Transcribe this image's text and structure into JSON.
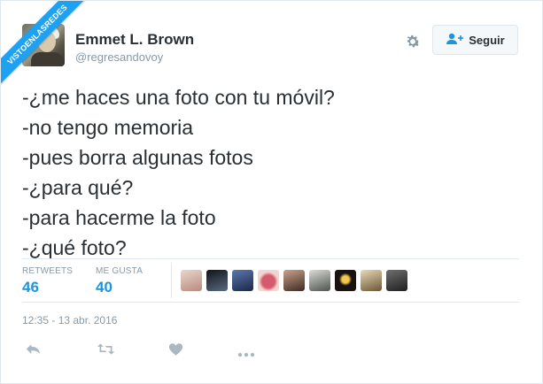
{
  "watermark": {
    "text": "VISTOENLASREDES"
  },
  "author": {
    "name": "Emmet L. Brown",
    "handle": "@regresandovoy"
  },
  "follow_button": {
    "label": "Seguir",
    "icon": "add-user-icon"
  },
  "settings_icon": "gear-icon",
  "tweet": {
    "lines": [
      "-¿me haces una foto con tu móvil?",
      "-no tengo memoria",
      "-pues borra algunas fotos",
      "-¿para qué?",
      "-para hacerme la foto",
      "-¿qué foto?"
    ]
  },
  "stats": {
    "retweets_label": "RETWEETS",
    "retweets_count": "46",
    "likes_label": "ME GUSTA",
    "likes_count": "40"
  },
  "likers": [
    {
      "icon": "liker-avatar",
      "color": "#c9a89a"
    },
    {
      "icon": "liker-avatar",
      "color": "#1f2630"
    },
    {
      "icon": "liker-avatar",
      "color": "#2c3e66"
    },
    {
      "icon": "liker-avatar",
      "color": "#d9707c"
    },
    {
      "icon": "liker-avatar",
      "color": "#6b4b3e"
    },
    {
      "icon": "liker-avatar",
      "color": "#8a8f8a"
    },
    {
      "icon": "liker-avatar",
      "color": "#2a1e1a"
    },
    {
      "icon": "liker-avatar",
      "color": "#a08a63"
    },
    {
      "icon": "liker-avatar",
      "color": "#3d3d3d"
    }
  ],
  "timestamp": "12:35 - 13 abr. 2016",
  "actions": [
    "reply-icon",
    "retweet-icon",
    "like-icon",
    "more-icon"
  ],
  "colors": {
    "accent": "#1b95e0",
    "muted": "#8899a6",
    "border": "#e1e8ed",
    "ribbon": "#1da1f2"
  }
}
